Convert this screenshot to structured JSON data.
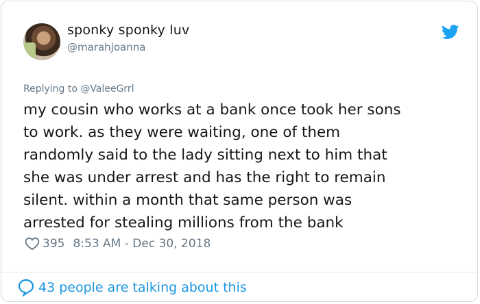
{
  "user": {
    "display_name": "sponky sponky luv",
    "handle": "@marahjoanna"
  },
  "reply": {
    "prefix": "Replying to",
    "mention": "@ValeeGrrl"
  },
  "tweet": {
    "lines": [
      "my cousin who works at a bank once took her sons",
      "to work. as they were waiting, one of them",
      "randomly said to the lady sitting next to him that",
      "she was under arrest and has the right to remain",
      "silent. within a month that same person was",
      "arrested for stealing millions from the bank"
    ]
  },
  "meta": {
    "likes": "395",
    "timestamp": "8:53 AM - Dec 30, 2018"
  },
  "footer": {
    "talking": "43 people are talking about this"
  },
  "colors": {
    "accent": "#1b95e0",
    "secondary_text": "#657786",
    "primary_text": "#14171a"
  },
  "icons": {
    "brand": "twitter-bird-icon",
    "like": "heart-outline-icon",
    "reply": "speech-bubble-icon"
  }
}
